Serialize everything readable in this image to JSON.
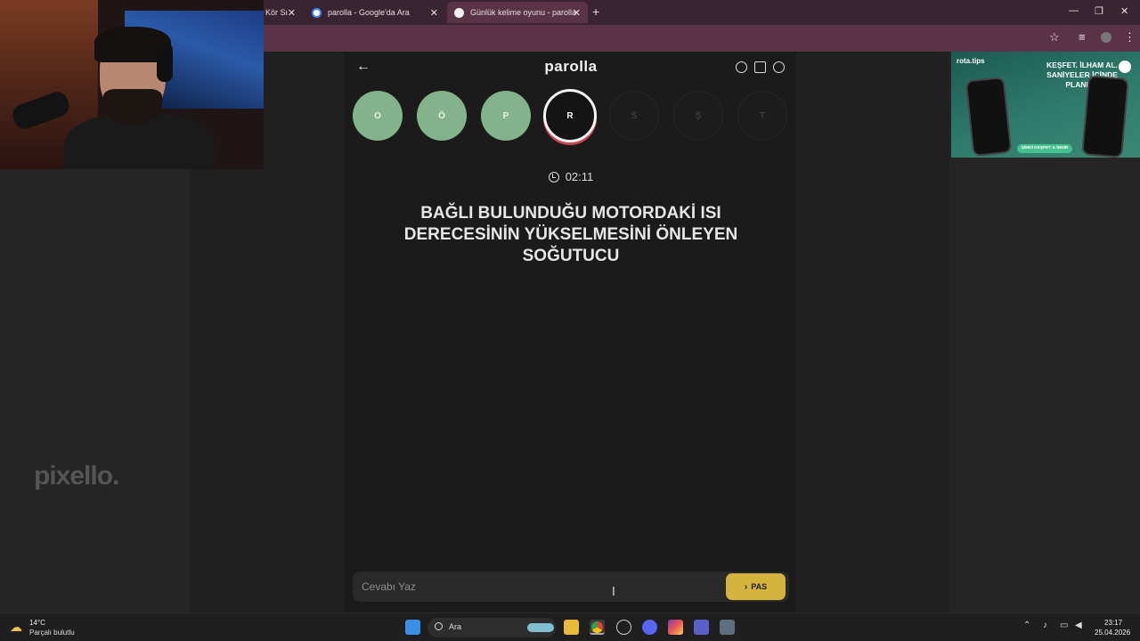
{
  "browser": {
    "tabs": [
      {
        "title": "Kör Sı",
        "active": false
      },
      {
        "title": "parolla - Google'da Ara",
        "active": false
      },
      {
        "title": "Günlük kelime oyunu - parolla",
        "active": true
      }
    ],
    "new_tab": "+"
  },
  "game": {
    "logo": "parolla",
    "letters": [
      {
        "letter": "O",
        "state": "done"
      },
      {
        "letter": "Ö",
        "state": "done"
      },
      {
        "letter": "P",
        "state": "done"
      },
      {
        "letter": "R",
        "state": "current"
      },
      {
        "letter": "S",
        "state": "todo"
      },
      {
        "letter": "Ş",
        "state": "todo"
      },
      {
        "letter": "T",
        "state": "todo"
      }
    ],
    "timer": "02:11",
    "question": "BAĞLI BULUNDUĞU MOTORDAKİ ISI DERECESİNİN YÜKSELMESİNİ ÖNLEYEN SOĞUTUCU",
    "answer_placeholder": "Cevabı Yaz",
    "answer_value": "",
    "pass_button": "PAS",
    "pass_color": "#d6b23e",
    "done_color": "#84b38b",
    "current_ring": "#c8484f"
  },
  "ad": {
    "brand": "rota.tips",
    "title": "KEŞFET. İLHAM AL. SANİYELER İÇİNDE PLANLA!",
    "cta": "ŞİMDİ KEŞFET & İNDİR"
  },
  "watermark": "pixello.",
  "taskbar": {
    "temperature": "14°C",
    "condition": "Parçalı bulutlu",
    "search_label": "Ara",
    "time": "23:17",
    "date": "25.04.2026"
  }
}
